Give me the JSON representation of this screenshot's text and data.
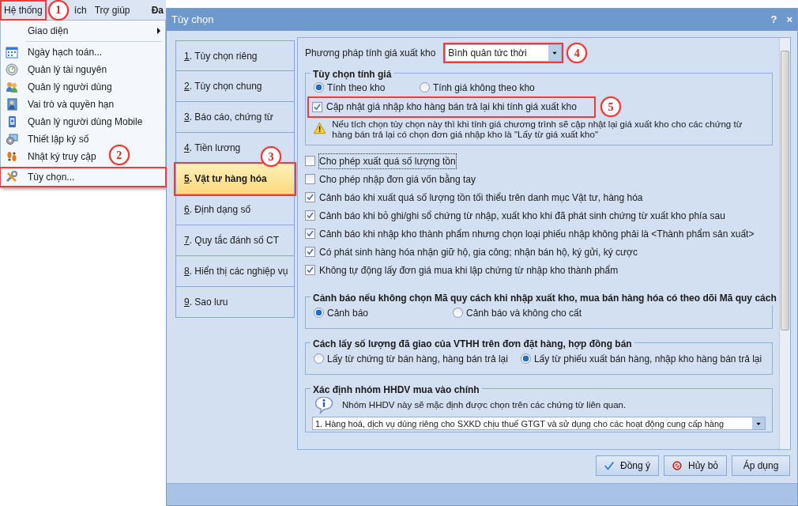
{
  "menubar": [
    {
      "label": "Hệ thống",
      "highlighted": true,
      "bold": false,
      "callout": "1"
    },
    {
      "label": "ích",
      "highlighted": false,
      "bold": false
    },
    {
      "label": "Trợ giúp",
      "highlighted": false,
      "bold": false
    },
    {
      "label": "Đa",
      "highlighted": false,
      "bold": true
    }
  ],
  "menu": {
    "items": [
      {
        "label": "Giao diện",
        "kind": "submenu",
        "highlighted": false
      },
      {
        "label": "Ngày hạch toán...",
        "kind": "command",
        "highlighted": false
      },
      {
        "label": "Quản lý tài nguyên",
        "kind": "command",
        "highlighted": false
      },
      {
        "label": "Quản lý người dùng",
        "kind": "command",
        "highlighted": false
      },
      {
        "label": "Vai trò và quyền hạn",
        "kind": "command",
        "highlighted": false
      },
      {
        "label": "Quản lý người dùng Mobile",
        "kind": "command",
        "highlighted": false
      },
      {
        "label": "Thiết lập ký số",
        "kind": "command",
        "highlighted": false
      },
      {
        "label": "Nhật ký truy cập",
        "kind": "command",
        "highlighted": false,
        "callout": "2"
      },
      {
        "label": "Tùy chọn...",
        "kind": "command",
        "highlighted": true
      }
    ]
  },
  "dialog": {
    "title": "Tùy chọn",
    "help": "?",
    "close": "×",
    "nav": [
      {
        "label": "1. Tùy chọn riêng",
        "selected": false,
        "highlighted": false
      },
      {
        "label": "2. Tùy chọn chung",
        "selected": false,
        "highlighted": false
      },
      {
        "label": "3. Báo cáo, chứng từ",
        "selected": false,
        "highlighted": false
      },
      {
        "label": "4. Tiền lương",
        "selected": false,
        "highlighted": false,
        "callout": "3"
      },
      {
        "label": "5. Vật tư hàng hóa",
        "selected": true,
        "highlighted": true
      },
      {
        "label": "6. Định dạng số",
        "selected": false,
        "highlighted": false
      },
      {
        "label": "7. Quy tắc đánh số CT",
        "selected": false,
        "highlighted": false
      },
      {
        "label": "8. Hiển thị các nghiệp vụ",
        "selected": false,
        "highlighted": false
      },
      {
        "label": "9. Sao lưu",
        "selected": false,
        "highlighted": false
      }
    ],
    "costing_method": {
      "label": "Phương pháp tính giá xuất kho",
      "value": "Bình quân tức thời",
      "highlighted": true,
      "callout": "4"
    },
    "costing_options": {
      "title": "Tùy chọn tính giá",
      "radios": [
        {
          "label": "Tính theo kho",
          "selected": true
        },
        {
          "label": "Tính giá không theo kho",
          "selected": false
        }
      ],
      "checkbox": {
        "label": "Cập nhật giá nhập kho hàng bán trả lại khi tính giá xuất kho",
        "checked": true,
        "highlighted": true,
        "callout": "5"
      },
      "warning": "Nếu tích chọn tùy chọn này thì khi tính giá chương trình sẽ cập nhật lại giá xuất kho cho các chứng từ hàng bán trả lại có chọn đơn giá nhập kho là \"Lấy từ giá xuất kho\""
    },
    "checkboxes": [
      {
        "label": "Cho phép xuất quá số lượng tồn",
        "checked": false,
        "focused": true
      },
      {
        "label": "Cho phép nhập đơn giá vốn bằng tay",
        "checked": false,
        "focused": false
      },
      {
        "label": "Cảnh báo khi xuất quá số lượng tồn tối thiểu trên danh mục Vật tư, hàng hóa",
        "checked": true,
        "focused": false
      },
      {
        "label": "Cảnh báo khi bỏ ghi/ghi sổ chứng từ nhập, xuất kho khi đã phát sinh chứng từ xuất kho phía sau",
        "checked": true,
        "focused": false
      },
      {
        "label": "Cảnh báo khi nhập kho thành phẩm nhưng chọn loại phiếu nhập không phải là <Thành phẩm sản xuất>",
        "checked": true,
        "focused": false
      },
      {
        "label": "Có phát sinh hàng hóa nhận giữ hộ, gia công; nhận bán hộ, ký gửi, ký cược",
        "checked": true,
        "focused": false
      },
      {
        "label": "Không tự động lấy đơn giá mua khi lập chứng từ nhập kho thành phẩm",
        "checked": true,
        "focused": false
      }
    ],
    "groups": [
      {
        "title": "Cảnh báo nếu không chọn Mã quy cách khi nhập xuất kho, mua bán hàng hóa có theo dõi Mã quy cách",
        "radios": [
          {
            "label": "Cảnh báo",
            "selected": true
          },
          {
            "label": "Cảnh báo và không cho cất",
            "selected": false
          }
        ]
      },
      {
        "title": "Cách lấy số lượng đã giao của VTHH trên đơn đặt hàng, hợp đồng bán",
        "radios": [
          {
            "label": "Lấy từ chứng từ bán hàng, hàng bán trả lại",
            "selected": false
          },
          {
            "label": "Lấy từ phiếu xuất bán hàng, nhập kho hàng bán trả lại",
            "selected": true
          }
        ]
      }
    ],
    "main_group": {
      "title": "Xác định nhóm HHDV mua vào chính",
      "info": "Nhóm HHDV này sẽ mặc định được chọn trên các chứng từ liên quan.",
      "value": "1. Hàng hoá, dịch vụ dùng riêng cho SXKD chịu thuế GTGT và sử dụng cho các hoạt động cung cấp hàng"
    },
    "buttons": [
      {
        "label": "Đồng ý",
        "kind": "ok"
      },
      {
        "label": "Hủy bỏ",
        "kind": "cancel"
      },
      {
        "label": "Áp dụng",
        "kind": "apply"
      }
    ]
  }
}
